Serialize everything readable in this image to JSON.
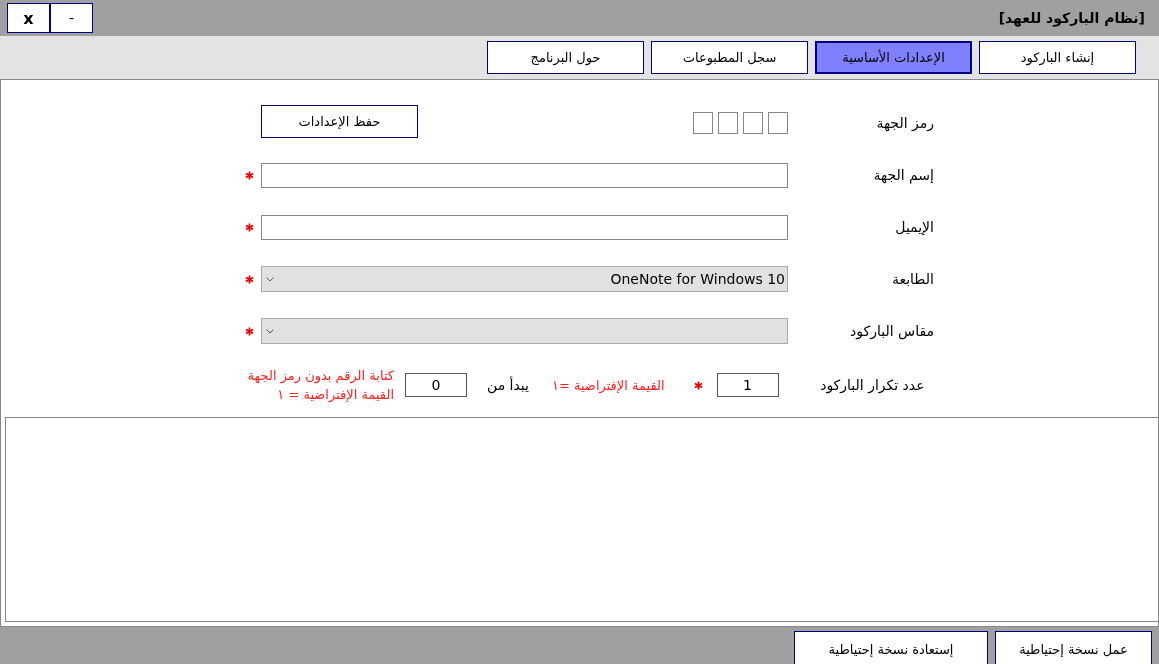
{
  "window": {
    "title": "[نظام الباركود للعهد]",
    "controls": [
      {
        "kind": "minimize",
        "label": "-"
      },
      {
        "kind": "close",
        "label": "x"
      }
    ]
  },
  "tabs": [
    {
      "label": "إنشاء الباركود",
      "selected": false
    },
    {
      "label": "الإعدادات الأساسية",
      "selected": true
    },
    {
      "label": "سجل المطبوعات",
      "selected": false
    },
    {
      "label": "حول البرنامج",
      "selected": false
    }
  ],
  "form": {
    "fields": [
      {
        "label": "رمز الجهة",
        "kind": "code",
        "button": "حفظ الإعدادات",
        "required": false
      },
      {
        "label": "إسم الجهة",
        "kind": "text",
        "required": true
      },
      {
        "label": "الإيميل",
        "kind": "text",
        "required": true
      },
      {
        "label": "الطابعة",
        "kind": "select",
        "value": "OneNote for Windows 10",
        "required": true
      },
      {
        "label": "مقاس الباركود",
        "kind": "select",
        "required": true
      }
    ],
    "repeat": {
      "label": "عدد تكرار الباركود",
      "value": "1",
      "required": true,
      "hint": "القيمة الإفتراضية =١",
      "start_label": "يبدأ من",
      "start_value": "0",
      "note": [
        "كتابة الرقم بدون رمز الجهة",
        "القيمة الإفتراضية = ١"
      ]
    }
  },
  "footer": {
    "buttons": [
      "عمل نسخة إحتياطية",
      "إستعادة نسخة إحتياطية"
    ]
  }
}
